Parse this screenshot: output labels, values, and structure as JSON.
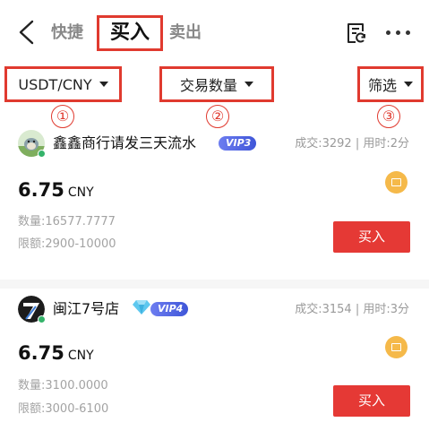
{
  "header": {
    "tabs": {
      "quick": "快捷",
      "buy": "买入",
      "sell": "卖出"
    },
    "icons": [
      "back-icon",
      "order-record-icon",
      "more-icon"
    ]
  },
  "filters": {
    "pair": "USDT/CNY",
    "quantity": "交易数量",
    "screen": "筛选"
  },
  "annotations": [
    "①",
    "②",
    "③"
  ],
  "merchants": [
    {
      "name": "鑫鑫商行请发三天流水",
      "vip": "VIP3",
      "stats": "成交:3292 | 用时:2分",
      "price": "6.75",
      "currency": "CNY",
      "quantity": "数量:16577.7777",
      "limit": "限额:2900-10000",
      "button": "买入"
    },
    {
      "name": "闽江7号店",
      "vip": "VIP4",
      "stats": "成交:3154 | 用时:3分",
      "price": "6.75",
      "currency": "CNY",
      "quantity": "数量:3100.0000",
      "limit": "限额:3000-6100",
      "button": "买入"
    }
  ],
  "colors": {
    "accent_red": "#e53935",
    "highlight_border": "#e03a2f",
    "vip_blue": "#4a5fe0",
    "coin_orange": "#f5b94a",
    "online_green": "#35b36a"
  }
}
